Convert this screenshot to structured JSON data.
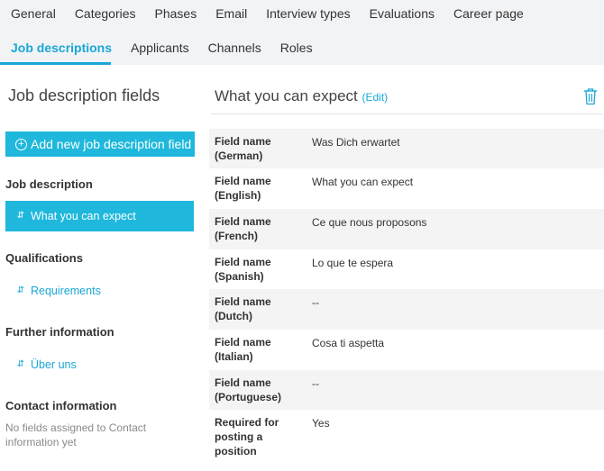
{
  "nav": {
    "row1": [
      "General",
      "Categories",
      "Phases",
      "Email",
      "Interview types",
      "Evaluations",
      "Career page"
    ],
    "row2": [
      "Job descriptions",
      "Applicants",
      "Channels",
      "Roles"
    ],
    "active": "Job descriptions"
  },
  "sidebar": {
    "title": "Job description fields",
    "add_button": "Add new job description field",
    "sections": [
      {
        "name": "Job description",
        "items": [
          "What you can expect"
        ]
      },
      {
        "name": "Qualifications",
        "items": [
          "Requirements"
        ]
      },
      {
        "name": "Further information",
        "items": [
          "Über uns"
        ]
      },
      {
        "name": "Contact information",
        "items": [],
        "note": "No fields assigned to Contact information yet"
      }
    ],
    "selected_item": "What you can expect"
  },
  "main": {
    "title": "What you can expect",
    "edit_label": "(Edit)",
    "fields": [
      {
        "label": "Field name (German)",
        "value": "Was Dich erwartet"
      },
      {
        "label": "Field name (English)",
        "value": "What you can expect"
      },
      {
        "label": "Field name (French)",
        "value": "Ce que nous proposons"
      },
      {
        "label": "Field name (Spanish)",
        "value": "Lo que te espera"
      },
      {
        "label": "Field name (Dutch)",
        "value": "--"
      },
      {
        "label": "Field name (Italian)",
        "value": "Cosa ti aspetta"
      },
      {
        "label": "Field name (Portuguese)",
        "value": "--"
      },
      {
        "label": "Required for posting a position",
        "value": "Yes"
      }
    ]
  },
  "colors": {
    "accent": "#1aa7d6",
    "button": "#1fb8dc",
    "nav_bg": "#f2f3f5",
    "row_shade": "#f4f4f4"
  },
  "icons": [
    "plus-circle-icon",
    "sort-icon",
    "trash-icon"
  ]
}
